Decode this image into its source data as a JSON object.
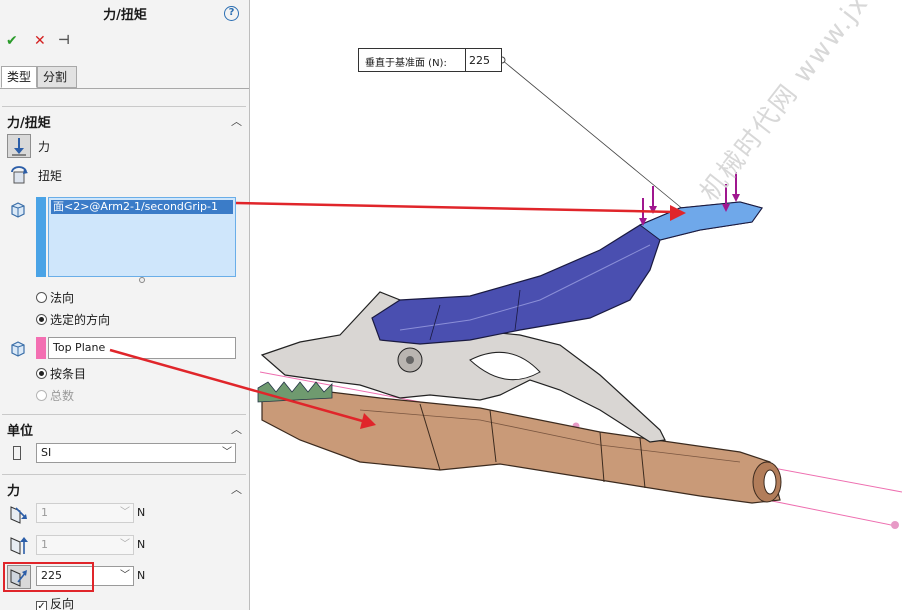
{
  "panel": {
    "title": "力/扭矩",
    "help": "?",
    "actions": {
      "ok": "✔",
      "cancel": "✕",
      "pin": "⊣"
    },
    "tabs": [
      "类型",
      "分割"
    ],
    "force_torque_section": {
      "title": "力/扭矩",
      "force_label": "力",
      "torque_label": "扭矩",
      "selected_entity": "面<2>@Arm2-1/secondGrip-1",
      "direction_options": [
        "法向",
        "选定的方向"
      ],
      "selected_direction": "选定的方向",
      "direction_reference": "Top Plane",
      "distribution_options": [
        "按条目",
        "总数"
      ],
      "selected_distribution": "按条目"
    },
    "units_section": {
      "title": "单位",
      "unit_value": "SI"
    },
    "force_section": {
      "title": "力",
      "components": [
        {
          "value": "1",
          "unit": "N",
          "enabled": false
        },
        {
          "value": "1",
          "unit": "N",
          "enabled": false
        },
        {
          "value": "225",
          "unit": "N",
          "enabled": true
        }
      ],
      "reverse_label": "反向",
      "reverse_checked": true
    }
  },
  "viewport": {
    "callout_label": "垂直于基准面 (N):",
    "callout_value": "225",
    "watermark": "机械时代网 www.jxage.com"
  },
  "colors": {
    "accent_blue": "#3b7cc8",
    "selection_pink": "#f36fb2",
    "highlight_red": "#e0252a",
    "grip_blue": "#4a4fb0",
    "grip_copper": "#c99a78"
  }
}
